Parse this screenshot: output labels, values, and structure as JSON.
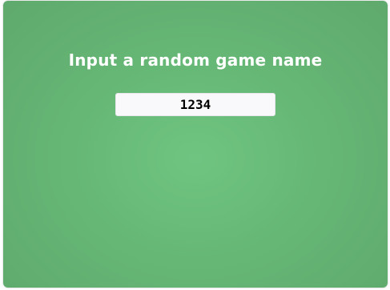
{
  "prompt": {
    "title": "Input a random game name"
  },
  "game_name_input": {
    "value": "1234"
  },
  "colors": {
    "panel_green": "#66b776",
    "title_text": "#ffffff",
    "input_bg": "#f9f9fb"
  }
}
